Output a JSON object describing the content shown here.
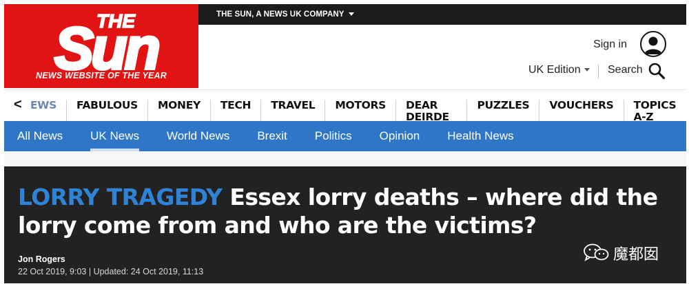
{
  "brand": {
    "logo_word": "Sun",
    "logo_article": "THE",
    "tagline": "NEWS WEBSITE OF THE YEAR",
    "company": "THE SUN, A NEWS UK COMPANY",
    "red": "#e21313",
    "dark": "#1b1b1b"
  },
  "header": {
    "signin": "Sign in",
    "edition": "UK Edition",
    "search": "Search"
  },
  "section_nav": {
    "back": "<",
    "items": [
      "EWS",
      "FABULOUS",
      "MONEY",
      "TECH",
      "TRAVEL",
      "MOTORS",
      "DEAR DEIRDE",
      "PUZZLES",
      "VOUCHERS",
      "TOPICS A-Z"
    ]
  },
  "sub_nav": {
    "items": [
      "All News",
      "UK News",
      "World News",
      "Brexit",
      "Politics",
      "Opinion",
      "Health News"
    ],
    "active": "UK News",
    "color": "#2f77c6"
  },
  "article": {
    "kicker": "LORRY TRAGEDY",
    "title": "Essex lorry deaths – where did the lorry come from and who are the victims?",
    "author": "Jon Rogers",
    "dates": "22 Oct 2019, 9:03 | Updated: 24 Oct 2019, 11:13"
  },
  "watermark": {
    "text": "魔都囡",
    "icon": "wechat-icon"
  }
}
